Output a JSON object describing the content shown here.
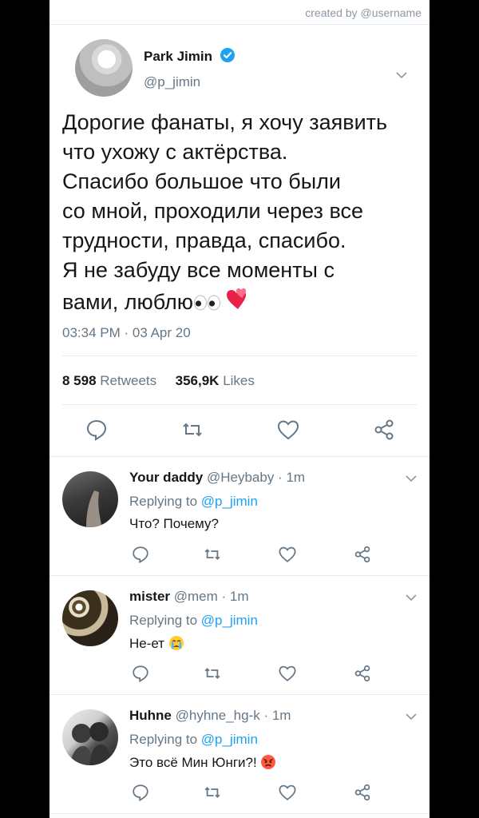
{
  "credit": "created by @username",
  "tweet": {
    "name": "Park Jimin",
    "handle": "@p_jimin",
    "text": "Дорогие фанаты, я хочу заявить\nчто ухожу с актёрства.\nСпасибо большое что были\nсо мной, проходили через все\nтрудности, правда, спасибо.\nЯ не забуду все моменты с\nвами, люблю",
    "timestamp": "03:34 PM · 03 Apr 20",
    "retweets_count": "8 598",
    "retweets_label": "Retweets",
    "likes_count": "356,9K",
    "likes_label": "Likes",
    "verified_color": "#1da1f2"
  },
  "replies": [
    {
      "name": "Your daddy",
      "meta": "@Heybaby · 1m",
      "replying_prefix": "Replying to",
      "replying_to": "@p_jimin",
      "text": "Что? Почему?",
      "emoji": ""
    },
    {
      "name": "mister",
      "meta": "@mem · 1m",
      "replying_prefix": "Replying to",
      "replying_to": "@p_jimin",
      "text": "Не-ет",
      "emoji": "crying-face"
    },
    {
      "name": "Huhne",
      "meta": "@hyhne_hg-k · 1m",
      "replying_prefix": "Replying to",
      "replying_to": "@p_jimin",
      "text": "Это всё Мин Юнги?!",
      "emoji": "angry-face"
    }
  ],
  "icons": [
    "reply-icon",
    "retweet-icon",
    "like-icon",
    "share-icon",
    "chevron-down-icon",
    "verified-icon"
  ]
}
